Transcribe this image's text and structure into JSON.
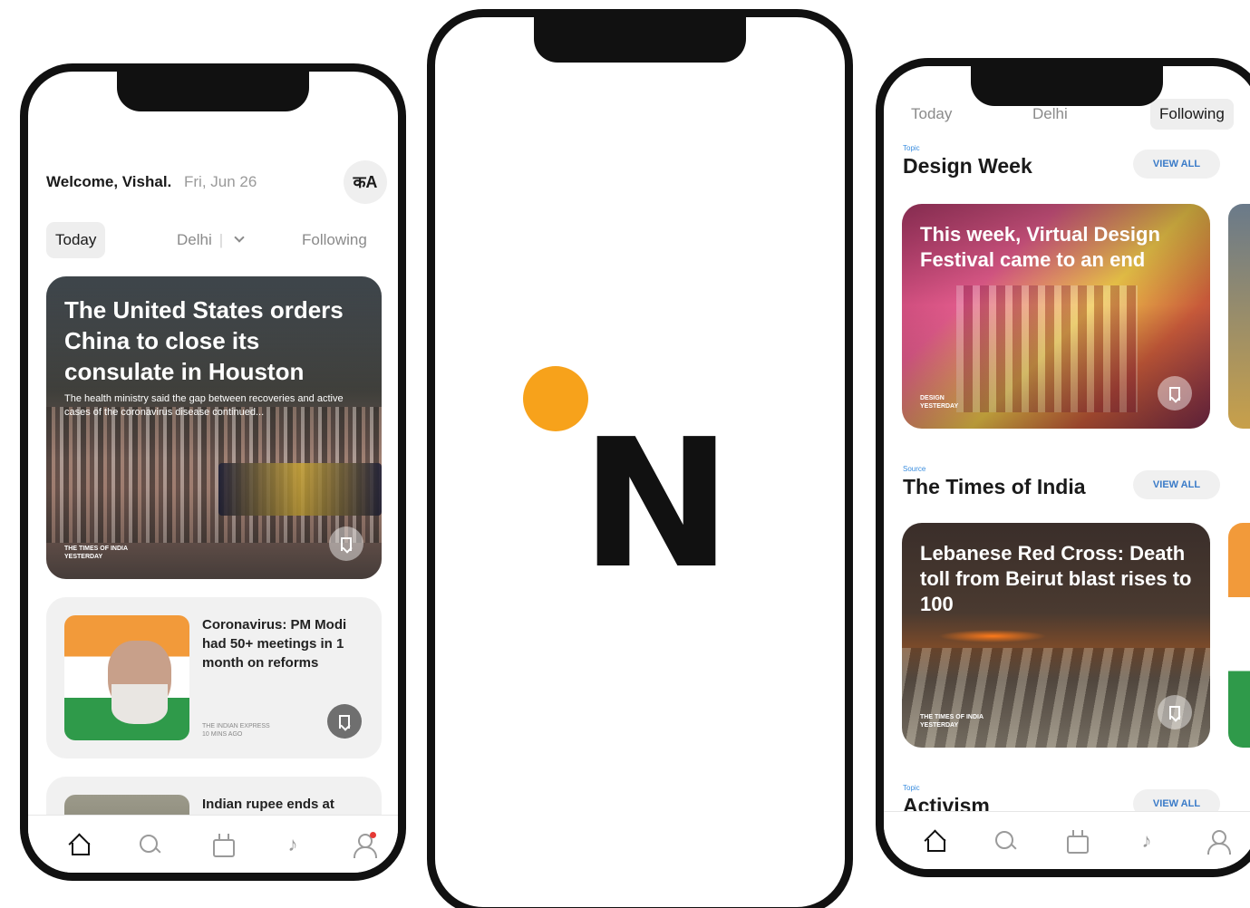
{
  "left_phone": {
    "welcome": "Welcome, Vishal.",
    "date": "Fri, Jun 26",
    "lang_icon": "translate-icon",
    "lang_glyph": "कA",
    "tabs": {
      "today": "Today",
      "city": "Delhi",
      "following": "Following"
    },
    "hero": {
      "title": "The United States orders China to close its consulate in Houston",
      "summary": "The health ministry said the gap between recoveries and active cases of the coronavirus disease continued...",
      "source": "THE TIMES OF INDIA",
      "time": "YESTERDAY"
    },
    "cards": [
      {
        "title": "Coronavirus: PM Modi had 50+ meetings in 1 month on reforms",
        "source": "THE INDIAN EXPRESS",
        "time": "10 MINS AGO"
      },
      {
        "title": "Indian rupee ends at two-week high against"
      }
    ],
    "nav": [
      "home-icon",
      "search-icon",
      "tv-icon",
      "music-icon",
      "profile-icon"
    ],
    "music_glyph": "♪"
  },
  "center_phone": {
    "logo_letter": "N",
    "accent_color": "#F7A21B"
  },
  "right_phone": {
    "tabs": {
      "today": "Today",
      "city": "Delhi",
      "following": "Following"
    },
    "sections": [
      {
        "kicker": "Topic",
        "title": "Design Week",
        "view_all": "VIEW ALL",
        "card": {
          "title": "This week, Virtual Design Festival came to an end",
          "source": "DESIGN",
          "time": "YESTERDAY"
        }
      },
      {
        "kicker": "Source",
        "title": "The Times of India",
        "view_all": "VIEW ALL",
        "card": {
          "title": "Lebanese Red Cross: Death toll from Beirut blast rises to 100",
          "source": "THE TIMES OF INDIA",
          "time": "YESTERDAY"
        }
      },
      {
        "kicker": "Topic",
        "title": "Activism",
        "view_all": "VIEW ALL"
      }
    ],
    "nav": [
      "home-icon",
      "search-icon",
      "tv-icon",
      "music-icon",
      "profile-icon"
    ],
    "music_glyph": "♪"
  }
}
